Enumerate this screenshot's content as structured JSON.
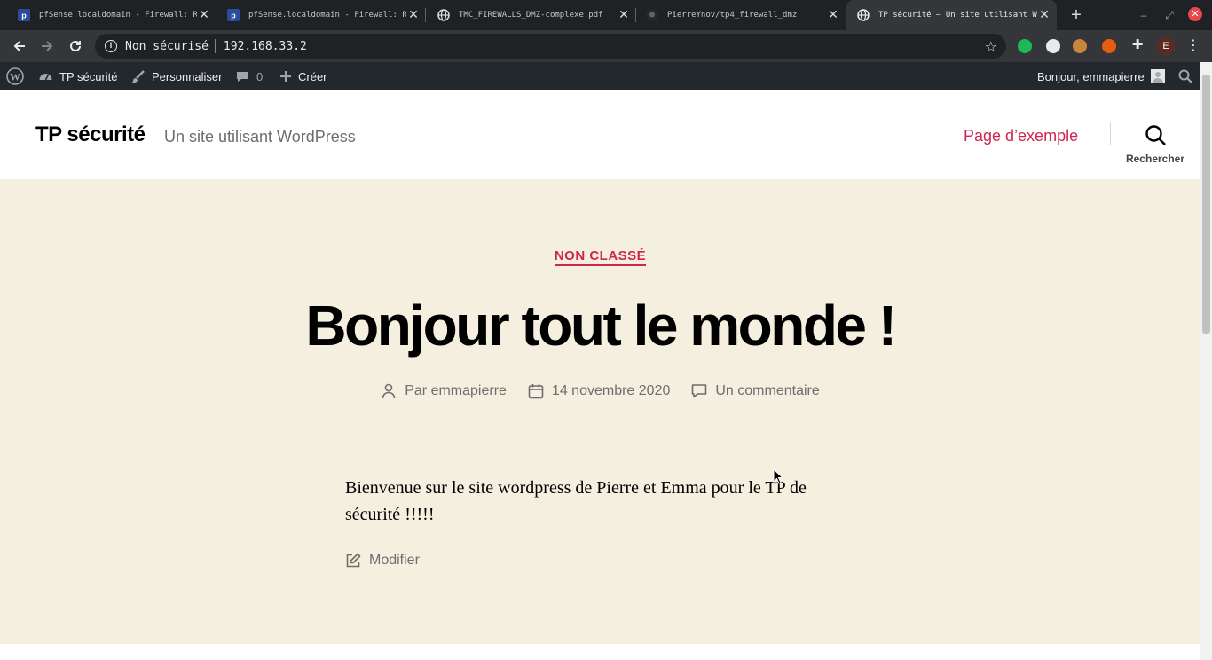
{
  "browser": {
    "tabs": [
      {
        "title": "pfSense.localdomain - Firewall: Rul",
        "icon": "pfsense-favicon",
        "active": false
      },
      {
        "title": "pfSense.localdomain - Firewall: Rul",
        "icon": "pfsense-favicon",
        "active": false
      },
      {
        "title": "TMC_FIREWALLS_DMZ-complexe.pdf",
        "icon": "globe-icon",
        "active": false
      },
      {
        "title": "PierreYnov/tp4_firewall_dmz",
        "icon": "github-icon",
        "active": false
      },
      {
        "title": "TP sécurité – Un site utilisant Wor",
        "icon": "globe-icon",
        "active": true
      }
    ],
    "security_label": "Non sécurisé",
    "url": "192.168.33.2",
    "profile_initial": "E"
  },
  "adminbar": {
    "site_name": "TP sécurité",
    "customize": "Personnaliser",
    "comments_count": "0",
    "new": "Créer",
    "greeting": "Bonjour, emmapierre"
  },
  "header": {
    "site_title": "TP sécurité",
    "description": "Un site utilisant WordPress",
    "menu_item": "Page d’exemple",
    "search_label": "Rechercher"
  },
  "post": {
    "category": "NON CLASSÉ",
    "title": "Bonjour tout le monde !",
    "author": "Par emmapierre",
    "date": "14 novembre 2020",
    "comments": "Un commentaire",
    "content": "Bienvenue sur le site wordpress de Pierre et Emma pour le TP de sécurité !!!!!",
    "edit": "Modifier"
  },
  "colors": {
    "accent": "#cd2653",
    "background": "#f5efe0",
    "adminbar": "#23282d",
    "chrome_tabbar": "#202124",
    "chrome_toolbar": "#35363a"
  }
}
